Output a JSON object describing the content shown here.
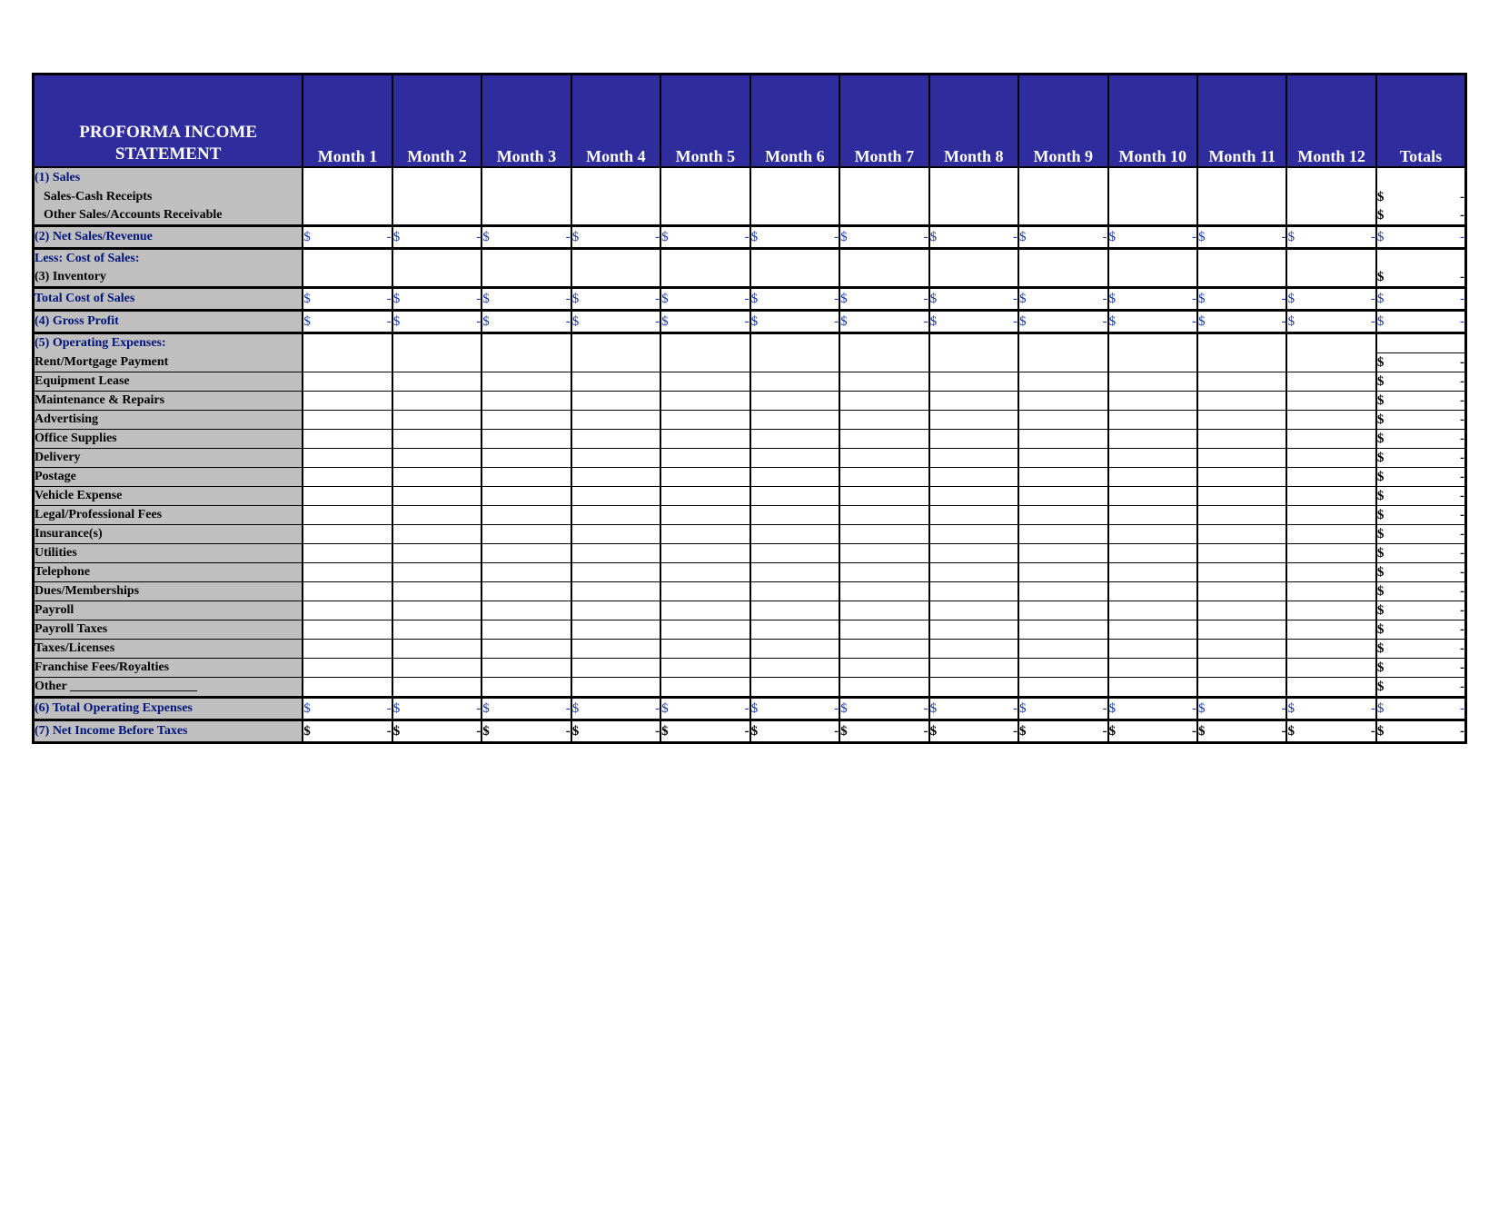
{
  "header": {
    "title_line1": "PROFORMA INCOME",
    "title_line2": "STATEMENT",
    "months": [
      "Month 1",
      "Month 2",
      "Month 3",
      "Month 4",
      "Month 5",
      "Month 6",
      "Month 7",
      "Month 8",
      "Month 9",
      "Month 10",
      "Month 11",
      "Month 12"
    ],
    "totals": "Totals"
  },
  "sym": {
    "dollar": "$",
    "dash": "-"
  },
  "rows": {
    "sales_hdr": "(1) Sales",
    "cash_receipts": "Sales-Cash Receipts",
    "other_sales": "Other Sales/Accounts Receivable",
    "net_sales": "(2) Net Sales/Revenue",
    "less_cos": "Less: Cost of Sales:",
    "inventory": "(3) Inventory",
    "total_cos": "Total Cost of Sales",
    "gross_profit": "(4) Gross Profit",
    "opex_hdr": "(5) Operating Expenses:",
    "total_opex": "(6) Total Operating Expenses",
    "net_income": "(7) Net Income Before Taxes"
  },
  "opex": [
    "Rent/Mortgage Payment",
    "Equipment Lease",
    "Maintenance & Repairs",
    "Advertising",
    "Office Supplies",
    "Delivery",
    "Postage",
    "Vehicle Expense",
    "Legal/Professional Fees",
    "Insurance(s)",
    "Utilities",
    "Telephone",
    "Dues/Memberships",
    "Payroll",
    "Payroll Taxes",
    "Taxes/Licenses",
    "Franchise Fees/Royalties",
    "Other ____________________"
  ]
}
